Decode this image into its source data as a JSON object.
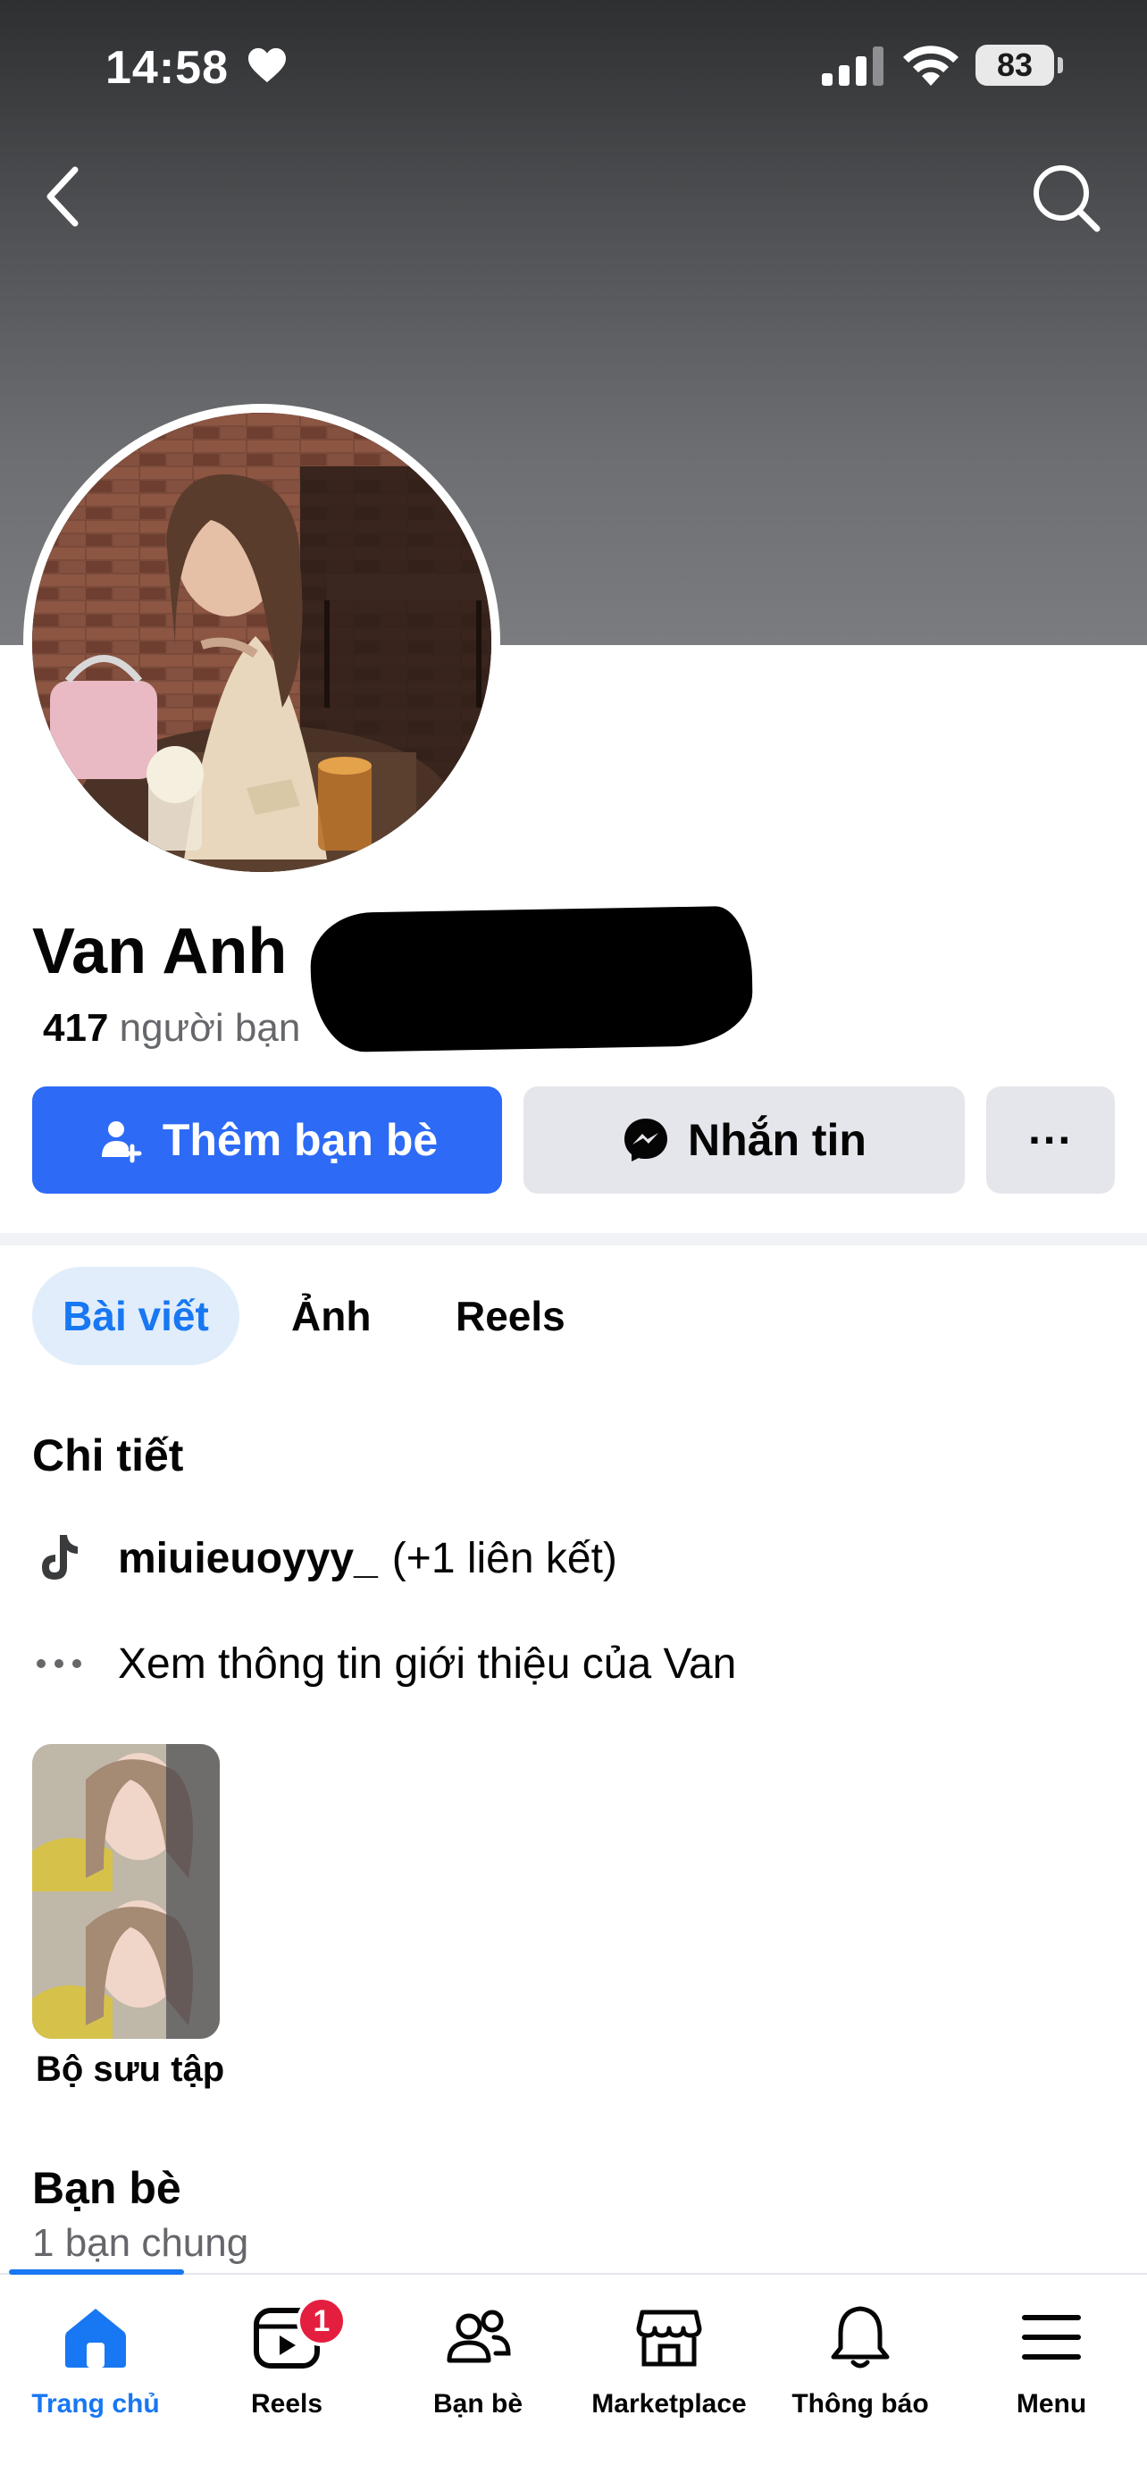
{
  "status_bar": {
    "time": "14:58",
    "battery": "83"
  },
  "profile": {
    "name": "Van Anh",
    "friends_count": "417",
    "friends_label": "người bạn"
  },
  "actions": {
    "add_friend": "Thêm bạn bè",
    "message": "Nhắn tin",
    "more": "···"
  },
  "tabs": [
    {
      "label": "Bài viết",
      "active": true
    },
    {
      "label": "Ảnh",
      "active": false
    },
    {
      "label": "Reels",
      "active": false
    }
  ],
  "details": {
    "title": "Chi tiết",
    "tiktok_username": "miuieuoyyy_",
    "tiktok_extra": "(+1 liên kết)",
    "about": "Xem thông tin giới thiệu của Van"
  },
  "collection": {
    "label": "Bộ sưu tập"
  },
  "friends_section": {
    "title": "Bạn bè",
    "mutual": "1 bạn chung"
  },
  "nav": [
    {
      "label": "Trang chủ",
      "icon": "home-icon",
      "active": true
    },
    {
      "label": "Reels",
      "icon": "reels-icon",
      "badge": "1"
    },
    {
      "label": "Bạn bè",
      "icon": "friends-icon"
    },
    {
      "label": "Marketplace",
      "icon": "marketplace-icon"
    },
    {
      "label": "Thông báo",
      "icon": "bell-icon"
    },
    {
      "label": "Menu",
      "icon": "menu-icon"
    }
  ],
  "colors": {
    "primary": "#2d6af6",
    "active_blue": "#1877f2",
    "tab_active_bg": "#e1edfb",
    "badge_red": "#e41e3f",
    "secondary_button": "#e4e6eb"
  }
}
